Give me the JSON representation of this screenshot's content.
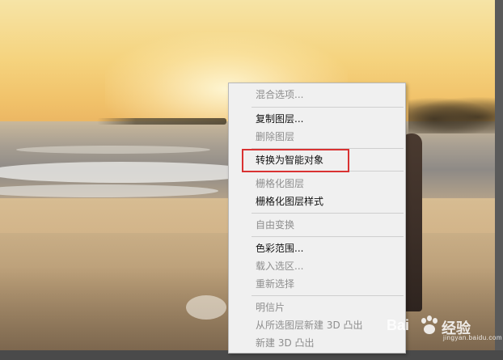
{
  "menu": {
    "items": [
      {
        "label": "混合选项...",
        "enabled": false
      },
      {
        "label": "复制图层...",
        "enabled": true
      },
      {
        "label": "删除图层",
        "enabled": false
      },
      {
        "label": "转换为智能对象",
        "enabled": true,
        "highlighted": true
      },
      {
        "label": "栅格化图层",
        "enabled": false
      },
      {
        "label": "栅格化图层样式",
        "enabled": true
      },
      {
        "label": "自由变换",
        "enabled": false
      },
      {
        "label": "色彩范围...",
        "enabled": true
      },
      {
        "label": "载入选区...",
        "enabled": false
      },
      {
        "label": "重新选择",
        "enabled": false
      },
      {
        "label": "明信片",
        "enabled": false
      },
      {
        "label": "从所选图层新建 3D 凸出",
        "enabled": false
      },
      {
        "label": "新建 3D 凸出",
        "enabled": false
      }
    ]
  },
  "watermark": {
    "brand_left": "Bai",
    "brand_right": "经验",
    "sub": "jingyan.baidu.com"
  },
  "colors": {
    "highlight_border": "#d93232",
    "menu_background": "#f0f0f0",
    "disabled_text": "#8e8e8e",
    "enabled_text": "#111111"
  }
}
